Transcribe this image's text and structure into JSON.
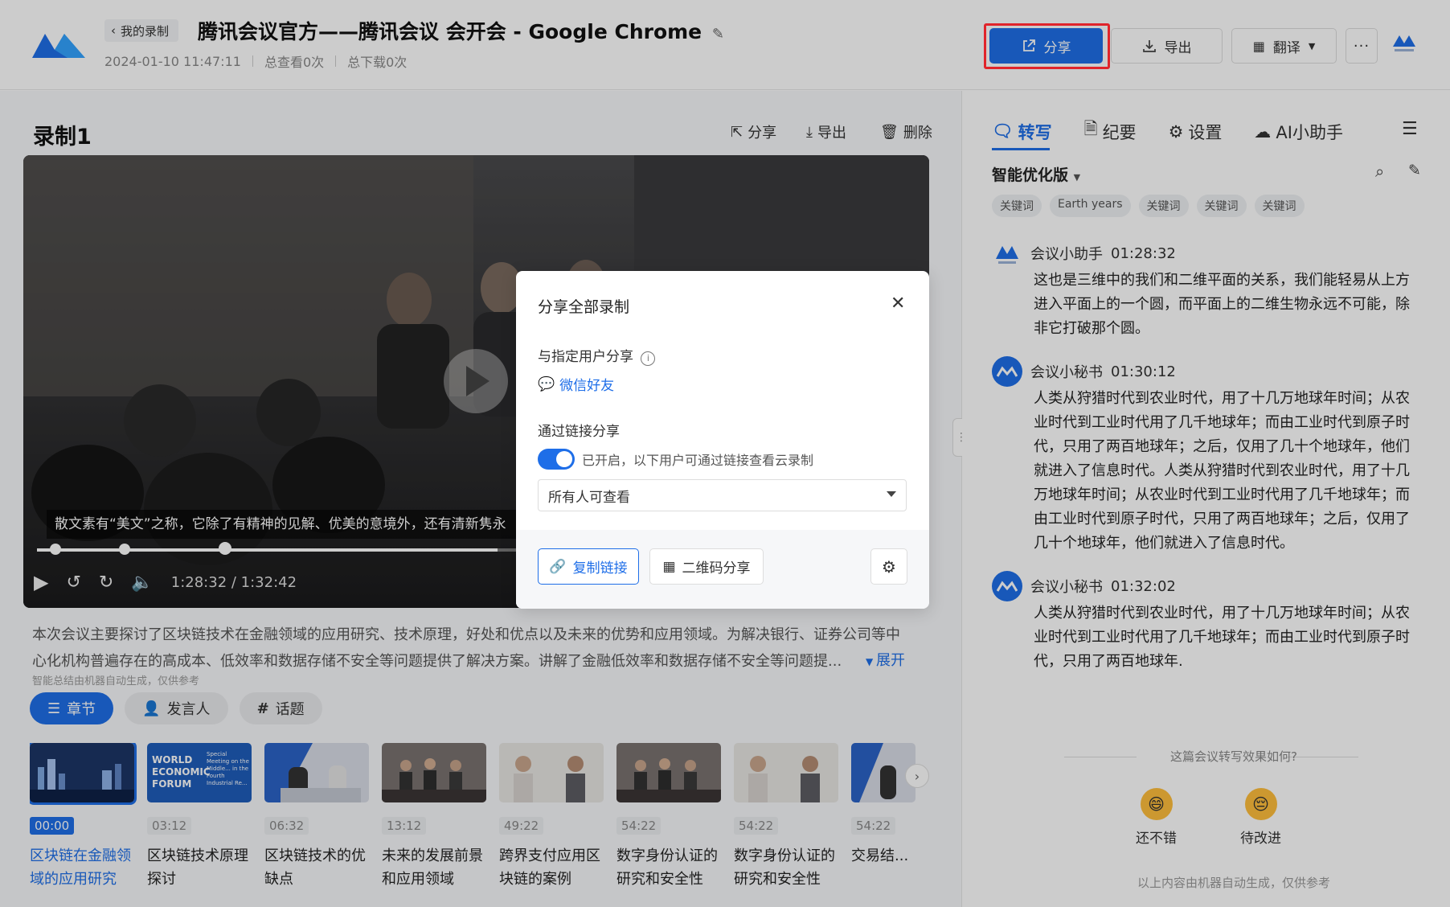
{
  "header": {
    "back_label": "我的录制",
    "title": "腾讯会议官方——腾讯会议 会开会 - Google Chrome",
    "date": "2024-01-10 11:47:11",
    "views": "总查看0次",
    "downloads": "总下载0次",
    "share_label": "分享",
    "export_label": "导出",
    "translate_label": "翻译"
  },
  "recording": {
    "title": "录制1",
    "share": "分享",
    "export": "导出",
    "delete": "删除",
    "caption": "散文素有“美文”之称，它除了有精神的见解、优美的意境外，还有清新隽永",
    "time": "1:28:32 / 1:32:42",
    "progress": 0.955
  },
  "summary": {
    "text": "本次会议主要探讨了区块链技术在金融领域的应用研究、技术原理，好处和优点以及未来的优势和应用领域。为解决银行、证券公司等中心化机构普遍存在的高成本、低效率和数据存储不安全等问题提供了解决方案。讲解了金融低效率和数据存储不安全等问题提...",
    "expand": "展开",
    "ai_note": "智能总结由机器自动生成，仅供参考"
  },
  "tabs": [
    {
      "label": "章节"
    },
    {
      "label": "发言人"
    },
    {
      "label": "话题"
    }
  ],
  "chapters": [
    {
      "time": "00:00",
      "title": "区块链在金融领域的应用研究"
    },
    {
      "time": "03:12",
      "title": "区块链技术原理探讨"
    },
    {
      "time": "06:32",
      "title": "区块链技术的优缺点"
    },
    {
      "time": "13:12",
      "title": "未来的发展前景和应用领域"
    },
    {
      "time": "49:22",
      "title": "跨界支付应用区块链的案例"
    },
    {
      "time": "54:22",
      "title": "数字身份认证的研究和安全性"
    },
    {
      "time": "54:22",
      "title": "数字身份认证的研究和安全性"
    },
    {
      "time": "54:22",
      "title": "交易结..."
    }
  ],
  "wef_thumb": {
    "line1": "WORLD",
    "line2": "ECONOMIC",
    "line3": "FORUM",
    "small": "Special Meeting on the Middle... in the Fourth Industrial Re..."
  },
  "right_panel": {
    "tabs": [
      "转写",
      "纪要",
      "设置",
      "AI小助手"
    ],
    "mode": "智能优化版",
    "keywords": [
      "关键词",
      "Earth years",
      "关键词",
      "关键词",
      "关键词"
    ],
    "entries": [
      {
        "speaker": "会议小助手",
        "time": "01:28:32",
        "text": "这也是三维中的我们和二维平面的关系，我们能轻易从上方进入平面上的一个圆，而平面上的二维生物永远不可能，除非它打破那个圆。"
      },
      {
        "speaker": "会议小秘书",
        "time": "01:30:12",
        "text": "人类从狩猎时代到农业时代，用了十几万地球年时间；从农业时代到工业时代用了几千地球年；而由工业时代到原子时代，只用了两百地球年；之后，仅用了几十个地球年，他们就进入了信息时代。人类从狩猎时代到农业时代，用了十几万地球年时间；从农业时代到工业时代用了几千地球年；而由工业时代到原子时代，只用了两百地球年；之后，仅用了几十个地球年，他们就进入了信息时代。"
      },
      {
        "speaker": "会议小秘书",
        "time": "01:32:02",
        "text": "人类从狩猎时代到农业时代，用了十几万地球年时间；从农业时代到工业时代用了几千地球年；而由工业时代到原子时代，只用了两百地球年."
      }
    ],
    "feedback_q": "这篇会议转写效果如何?",
    "good": "还不错",
    "improve": "待改进",
    "bottom_note": "以上内容由机器自动生成，仅供参考"
  },
  "modal": {
    "title": "分享全部录制",
    "specific_label": "与指定用户分享",
    "wechat": "微信好友",
    "link_label": "通过链接分享",
    "toggle_text": "已开启，以下用户可通过链接查看云录制",
    "toggle_on": true,
    "visibility": "所有人可查看",
    "copy_link": "复制链接",
    "qr_share": "二维码分享"
  },
  "colors": {
    "accent": "#1e6ee8",
    "highlight": "#e0242a"
  }
}
